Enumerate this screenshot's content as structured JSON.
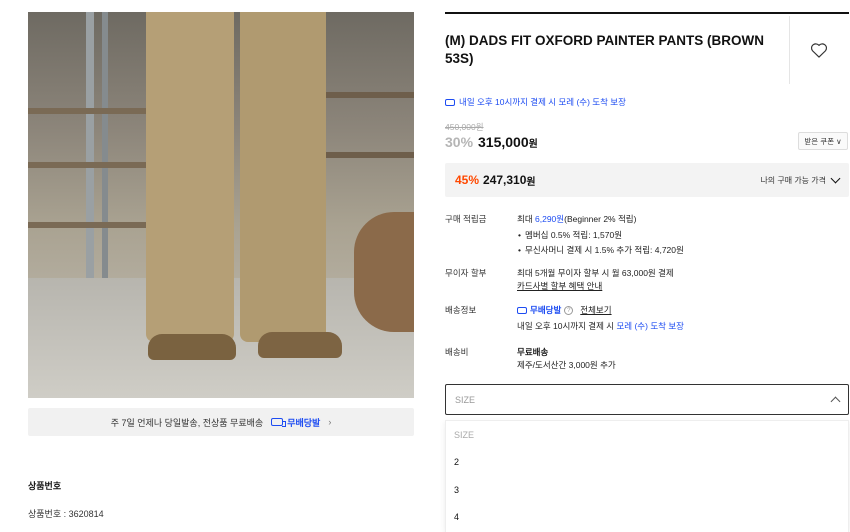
{
  "gallery": {
    "shipping_notice": "주 7일 언제나 당일발송, 전상품 무료배송",
    "free_shipping_label": "무배당발",
    "chevron": "›"
  },
  "product_number": {
    "heading": "상품번호",
    "value": "상품번호 : 3620814"
  },
  "product": {
    "title": "(M) DADS FIT OXFORD PAINTER PANTS (BROWN 53S)",
    "delivery_promise": "내일 오후 10시까지 결제 시 모레 (수) 도착 보장",
    "original_price": "450,000원",
    "discount_rate": "30%",
    "price": "315,000",
    "price_unit": "원",
    "coupon_button": "받은 쿠폰",
    "coupon_chevron": "∨"
  },
  "my_price": {
    "discount_rate": "45%",
    "price": "247,310",
    "unit": "원",
    "label": "나의 구매 가능 가격"
  },
  "points": {
    "label": "구매 적립금",
    "line1_prefix": "최대 ",
    "line1_amount": "6,290원",
    "line1_suffix": "(Beginner 2% 적립)",
    "line2": "멤버십 0.5% 적립: 1,570원",
    "line3": "무신사머니 결제 시 1.5% 추가 적립: 4,720원"
  },
  "installment": {
    "label": "무이자 할부",
    "line1": "최대 5개월 무이자 할부 시 월 63,000원 결제",
    "link": "카드사별 할부 혜택 안내"
  },
  "shipping_info": {
    "label": "배송정보",
    "badge": "무배당발",
    "help": "?",
    "link": "전체보기",
    "line2_prefix": "내일 오후 10시까지 결제 시 ",
    "line2_highlight": "모레 (수) 도착 보장"
  },
  "shipping_fee": {
    "label": "배송비",
    "line1": "무료배송",
    "line2": "제주/도서산간 3,000원 추가"
  },
  "size": {
    "placeholder": "SIZE",
    "options": [
      "SIZE",
      "2",
      "3",
      "4"
    ]
  },
  "colors": {
    "accent_blue": "#1d4cf2",
    "discount_orange": "#ff4800"
  }
}
